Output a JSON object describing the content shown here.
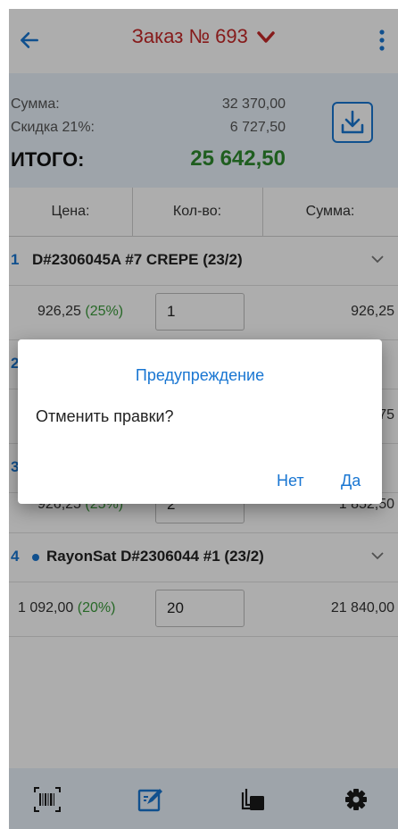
{
  "header": {
    "title": "Заказ № 693",
    "back_icon": "arrow-left-icon",
    "dropdown_icon": "chevron-down-icon",
    "menu_icon": "more-vertical-icon"
  },
  "summary": {
    "sum_label": "Сумма:",
    "sum_value": "32 370,00",
    "discount_label": "Скидка 21%:",
    "discount_value": "6 727,50",
    "total_label": "ИТОГО:",
    "total_value": "25 642,50",
    "download_icon": "download-icon"
  },
  "columns": {
    "price": "Цена:",
    "qty": "Кол-во:",
    "sum": "Сумма:"
  },
  "items": [
    {
      "num": "1",
      "name": "D#2306045A #7 CREPE (23/2)",
      "price": "926,25",
      "pct": "(25%)",
      "qty": "1",
      "sum": "926,25",
      "dot": false
    },
    {
      "num": "2",
      "name": "",
      "price": "",
      "pct": "",
      "qty": "",
      "sum": "75",
      "dot": false
    },
    {
      "num": "3",
      "name": "",
      "price": "926,25",
      "pct": "(25%)",
      "qty": "2",
      "sum": "1 852,50",
      "dot": false
    },
    {
      "num": "4",
      "name": "RayonSat D#2306044 #1 (23/2)",
      "price": "1 092,00",
      "pct": "(20%)",
      "qty": "20",
      "sum": "21 840,00",
      "dot": true
    }
  ],
  "dialog": {
    "title": "Предупреждение",
    "message": "Отменить правки?",
    "no_label": "Нет",
    "yes_label": "Да"
  },
  "bottom_nav": [
    "barcode-scan-icon",
    "edit-note-icon",
    "copy-stack-icon",
    "settings-gear-icon"
  ],
  "colors": {
    "accent": "#1976d2",
    "title": "#c62828",
    "total": "#2e8b2e",
    "summary_bg": "#e9f2fb"
  }
}
